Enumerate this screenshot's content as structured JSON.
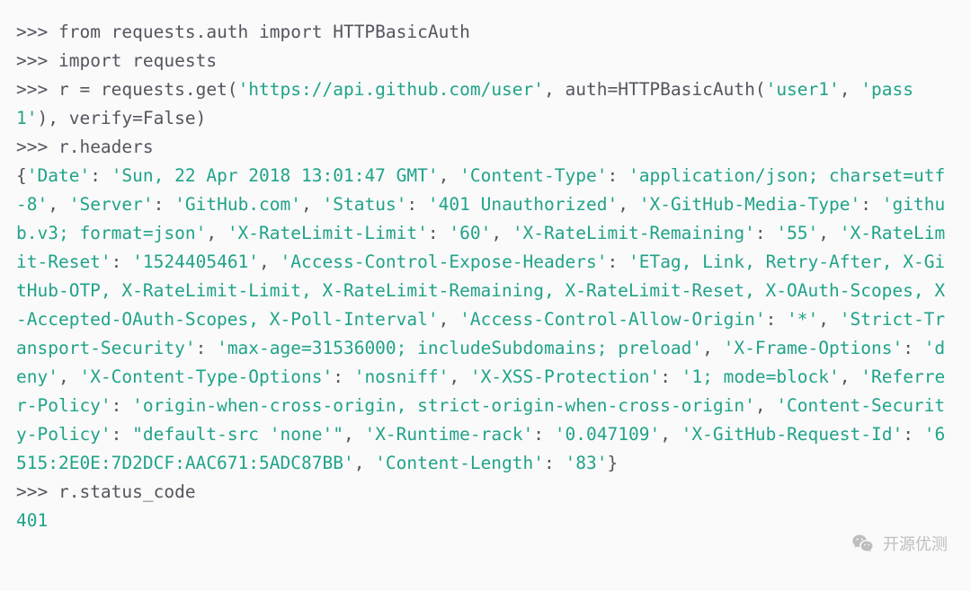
{
  "prompt": ">>> ",
  "lines": {
    "l1_pre": "from requests.auth import HTTPBasicAuth",
    "l2_pre": "import requests",
    "l3_a": "r = requests.get(",
    "l3_url": "'https://api.github.com/user'",
    "l3_b": ", auth=HTTPBasicAuth(",
    "l3_user": "'user1'",
    "l3_c": ", ",
    "l3_pass": "'pass1'",
    "l3_d": "), verify=False)",
    "l4": "r.headers",
    "headers_open": "{",
    "headers_close": "}",
    "hk_date": "'Date'",
    "hv_date": "'Sun, 22 Apr 2018 13:01:47 GMT'",
    "hk_ct": "'Content-Type'",
    "hv_ct": "'application/json; charset=utf-8'",
    "hk_srv": "'Server'",
    "hv_srv": "'GitHub.com'",
    "hk_st": "'Status'",
    "hv_st": "'401 Unauthorized'",
    "hk_gmt": "'X-GitHub-Media-Type'",
    "hv_gmt": "'github.v3; format=json'",
    "hk_rl": "'X-RateLimit-Limit'",
    "hv_rl": "'60'",
    "hk_rr": "'X-RateLimit-Remaining'",
    "hv_rr": "'55'",
    "hk_rrs": "'X-RateLimit-Reset'",
    "hv_rrs": "'1524405461'",
    "hk_aceh": "'Access-Control-Expose-Headers'",
    "hv_aceh": "'ETag, Link, Retry-After, X-GitHub-OTP, X-RateLimit-Limit, X-RateLimit-Remaining, X-RateLimit-Reset, X-OAuth-Scopes, X-Accepted-OAuth-Scopes, X-Poll-Interval'",
    "hk_acao": "'Access-Control-Allow-Origin'",
    "hv_acao": "'*'",
    "hk_sts": "'Strict-Transport-Security'",
    "hv_sts": "'max-age=31536000; includeSubdomains; preload'",
    "hk_xfo": "'X-Frame-Options'",
    "hv_xfo": "'deny'",
    "hk_xcto": "'X-Content-Type-Options'",
    "hv_xcto": "'nosniff'",
    "hk_xxp": "'X-XSS-Protection'",
    "hv_xxp": "'1; mode=block'",
    "hk_rp": "'Referrer-Policy'",
    "hv_rp": "'origin-when-cross-origin, strict-origin-when-cross-origin'",
    "hk_csp": "'Content-Security-Policy'",
    "hv_csp": "\"default-src 'none'\"",
    "hk_xrr": "'X-Runtime-rack'",
    "hv_xrr": "'0.047109'",
    "hk_xgr": "'X-GitHub-Request-Id'",
    "hv_xgr": "'6515:2E0E:7D2DCF:AAC671:5ADC87BB'",
    "hk_cl": "'Content-Length'",
    "hv_cl": "'83'",
    "colon": ": ",
    "comma": ", ",
    "l5": "r.status_code",
    "status": "401"
  },
  "watermark": {
    "text": "开源优测"
  }
}
